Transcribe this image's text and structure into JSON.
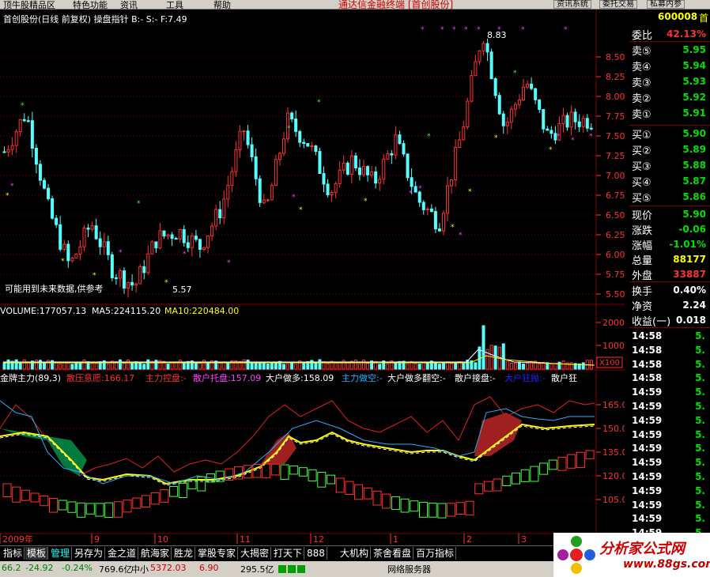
{
  "menu": {
    "items": [
      "顶牛股精品区",
      "特色功能",
      "资讯",
      "工具",
      "帮助"
    ],
    "title": "通达信金融终端 [首创股份]",
    "right_buttons": [
      "资讯系统",
      "委托交易",
      "私募内参"
    ]
  },
  "chart": {
    "header": "首创股份(日线 前复权) 操盘指针 B:- S:- F:7.49",
    "price_axis": [
      "8.50",
      "8.25",
      "8.00",
      "7.75",
      "7.50",
      "7.25",
      "7.00",
      "6.75",
      "6.50",
      "6.25",
      "6.00",
      "5.75",
      "5.50"
    ],
    "high_label": "8.83",
    "low_label": "5.57",
    "warning": "可能用到未来数据,供参考",
    "volume_header": {
      "vol": "VOLUME:177057.13",
      "ma5": "MA5:224115.20",
      "ma10": "MA10:220484.00"
    },
    "volume_axis": [
      "20000",
      "10000"
    ],
    "volume_unit": "X100",
    "ind_header": {
      "name": "金牌主力(89,3)",
      "items": [
        {
          "text": "散压意愿:166.17",
          "color": "#ff3030"
        },
        {
          "text": "主力控盘:-",
          "color": "#ff3030"
        },
        {
          "text": "散户托盘:157.09",
          "color": "#ff40ff"
        },
        {
          "text": "大户做多:158.09",
          "color": "#ffffff"
        },
        {
          "text": "主力做空:-",
          "color": "#20b0ff"
        },
        {
          "text": "大户做多翻空:-",
          "color": "#ffffff"
        },
        {
          "text": "散户接盘:-",
          "color": "#ffffff"
        },
        {
          "text": "大户狂抛:-",
          "color": "#2020ff"
        },
        {
          "text": "散户狂",
          "color": "#ffffff"
        }
      ]
    },
    "ind_axis": [
      "165.0",
      "150.0",
      "135.0",
      "120.0",
      "105.0"
    ],
    "date_axis": [
      "2009年",
      "9",
      "10",
      "11",
      "12",
      "1",
      "2",
      "3"
    ],
    "colors": {
      "up": "#ff3030",
      "down": "#54ffff",
      "grid": "#800000",
      "axis_text": "#ff3030"
    }
  },
  "quotes": {
    "code": "600008",
    "name": "首",
    "weibi": {
      "label": "委比",
      "value": "42.13%"
    },
    "sells": [
      {
        "label": "卖⑤",
        "value": "5.95"
      },
      {
        "label": "卖④",
        "value": "5.94"
      },
      {
        "label": "卖③",
        "value": "5.93"
      },
      {
        "label": "卖②",
        "value": "5.92"
      },
      {
        "label": "卖①",
        "value": "5.91"
      }
    ],
    "buys": [
      {
        "label": "买①",
        "value": "5.90"
      },
      {
        "label": "买②",
        "value": "5.89"
      },
      {
        "label": "买③",
        "value": "5.88"
      },
      {
        "label": "买④",
        "value": "5.87"
      },
      {
        "label": "买⑤",
        "value": "5.86"
      }
    ],
    "stats": [
      {
        "label": "现价",
        "value": "5.90",
        "color": "#00e000"
      },
      {
        "label": "涨跌",
        "value": "-0.06",
        "color": "#00e000"
      },
      {
        "label": "涨幅",
        "value": "-1.01%",
        "color": "#00e000"
      },
      {
        "label": "总量",
        "value": "88177",
        "color": "#ffff00"
      },
      {
        "label": "外盘",
        "value": "33887",
        "color": "#ff3030"
      }
    ],
    "stats2": [
      {
        "label": "换手",
        "value": "0.40%"
      },
      {
        "label": "净资",
        "value": "2.24"
      },
      {
        "label": "收益(一)",
        "value": "0.018"
      }
    ],
    "ticks": [
      {
        "time": "14:58",
        "price": "5."
      },
      {
        "time": "14:58",
        "price": "5."
      },
      {
        "time": "14:58",
        "price": "5."
      },
      {
        "time": "14:58",
        "price": "5."
      },
      {
        "time": "14:59",
        "price": "5."
      },
      {
        "time": "14:59",
        "price": "5."
      },
      {
        "time": "14:59",
        "price": "5."
      },
      {
        "time": "14:59",
        "price": "5."
      },
      {
        "time": "14:59",
        "price": "5."
      },
      {
        "time": "14:59",
        "price": "5."
      },
      {
        "time": "14:59",
        "price": "5."
      },
      {
        "time": "14:59",
        "price": "5."
      },
      {
        "time": "14:59",
        "price": "5."
      },
      {
        "time": "14:59",
        "price": "5."
      },
      {
        "time": "14:59",
        "price": "5."
      }
    ]
  },
  "tabs": [
    "指标",
    "模板",
    "管理",
    "另存为",
    "金之道",
    "航海家",
    "胜龙",
    "掌股专家",
    "大揭密",
    "打天下",
    "888",
    "大机构",
    "茶舍看盘",
    "百万指标"
  ],
  "status": {
    "index1": "66.2",
    "change1": "-24.92",
    "pct1": "-0.24%",
    "amount1": "769.6亿",
    "board": "中小",
    "index2": "5372.03",
    "change2": "6.90",
    "amount2": "295.5亿",
    "server": "网络服务器"
  },
  "watermark": {
    "title": "分析家公式网",
    "url": "www.88gs.com"
  }
}
